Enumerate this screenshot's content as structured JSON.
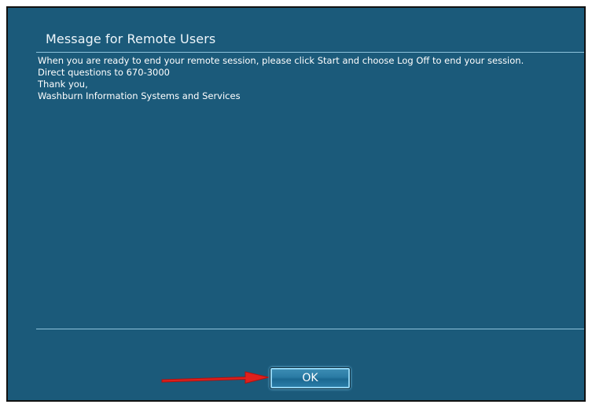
{
  "dialog": {
    "title": "Message for Remote Users",
    "message_lines": [
      "When you are ready to end your remote session, please click Start and choose Log Off to end your session.",
      "Direct questions to 670-3000",
      "Thank you,",
      "Washburn Information Systems and Services"
    ],
    "ok_label": "OK"
  },
  "colors": {
    "background": "#1b5a7a",
    "rule": "#8fc3dc",
    "arrow": "#e0201c"
  }
}
